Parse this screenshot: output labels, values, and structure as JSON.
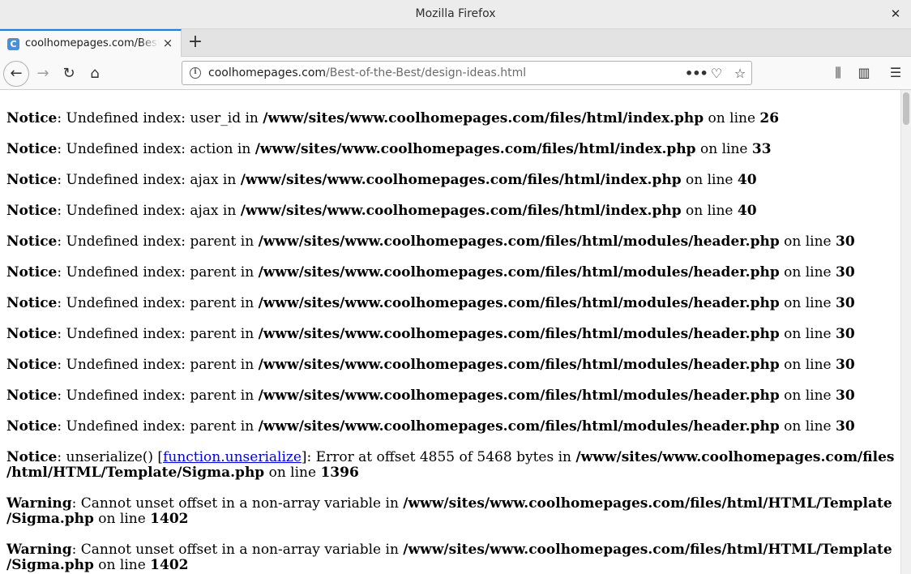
{
  "window": {
    "title": "Mozilla Firefox",
    "close_glyph": "✕"
  },
  "tab": {
    "favicon_letter": "C",
    "label": "coolhomepages.com/Best-of-the-Best/design-ideas.html",
    "close_glyph": "×"
  },
  "newtab_glyph": "+",
  "nav": {
    "back_glyph": "←",
    "forward_glyph": "→",
    "reload_glyph": "↻",
    "home_glyph": "⌂"
  },
  "url": {
    "host": "coolhomepages.com",
    "path": "/Best-of-the-Best/design-ideas.html"
  },
  "urlbar_icons": {
    "page_actions": "•••",
    "pocket": "♡",
    "bookmark": "☆"
  },
  "toolbar": {
    "library": "⫼",
    "sidebar": "▥",
    "menu": "☰"
  },
  "messages": [
    {
      "level": "Notice",
      "pre": ": Undefined index: user_id in ",
      "path": "/www/sites/www.coolhomepages.com/files/html/index.php",
      "mid": " on line ",
      "line": "26"
    },
    {
      "level": "Notice",
      "pre": ": Undefined index: action in ",
      "path": "/www/sites/www.coolhomepages.com/files/html/index.php",
      "mid": " on line ",
      "line": "33"
    },
    {
      "level": "Notice",
      "pre": ": Undefined index: ajax in ",
      "path": "/www/sites/www.coolhomepages.com/files/html/index.php",
      "mid": " on line ",
      "line": "40"
    },
    {
      "level": "Notice",
      "pre": ": Undefined index: ajax in ",
      "path": "/www/sites/www.coolhomepages.com/files/html/index.php",
      "mid": " on line ",
      "line": "40"
    },
    {
      "level": "Notice",
      "pre": ": Undefined index: parent in ",
      "path": "/www/sites/www.coolhomepages.com/files/html/modules/header.php",
      "mid": " on line ",
      "line": "30"
    },
    {
      "level": "Notice",
      "pre": ": Undefined index: parent in ",
      "path": "/www/sites/www.coolhomepages.com/files/html/modules/header.php",
      "mid": " on line ",
      "line": "30"
    },
    {
      "level": "Notice",
      "pre": ": Undefined index: parent in ",
      "path": "/www/sites/www.coolhomepages.com/files/html/modules/header.php",
      "mid": " on line ",
      "line": "30"
    },
    {
      "level": "Notice",
      "pre": ": Undefined index: parent in ",
      "path": "/www/sites/www.coolhomepages.com/files/html/modules/header.php",
      "mid": " on line ",
      "line": "30"
    },
    {
      "level": "Notice",
      "pre": ": Undefined index: parent in ",
      "path": "/www/sites/www.coolhomepages.com/files/html/modules/header.php",
      "mid": " on line ",
      "line": "30"
    },
    {
      "level": "Notice",
      "pre": ": Undefined index: parent in ",
      "path": "/www/sites/www.coolhomepages.com/files/html/modules/header.php",
      "mid": " on line ",
      "line": "30"
    },
    {
      "level": "Notice",
      "pre": ": Undefined index: parent in ",
      "path": "/www/sites/www.coolhomepages.com/files/html/modules/header.php",
      "mid": " on line ",
      "line": "30"
    }
  ],
  "unserialize_msg": {
    "level": "Notice",
    "pre": ": unserialize() [",
    "link": "function.unserialize",
    "post": "]: Error at offset 4855 of 5468 bytes in ",
    "path_1": "/www/sites/www.coolhomepages.com/files",
    "path_2": "/html/HTML/Template/Sigma.php",
    "mid": " on line ",
    "line": "1396"
  },
  "warnings": [
    {
      "level": "Warning",
      "pre": ": Cannot unset offset in a non-array variable in ",
      "path_1": "/www/sites/www.coolhomepages.com/files/html/HTML/Template",
      "path_2": "/Sigma.php",
      "mid": " on line ",
      "line": "1402"
    },
    {
      "level": "Warning",
      "pre": ": Cannot unset offset in a non-array variable in ",
      "path_1": "/www/sites/www.coolhomepages.com/files/html/HTML/Template",
      "path_2": "/Sigma.php",
      "mid": " on line ",
      "line": "1402"
    }
  ]
}
